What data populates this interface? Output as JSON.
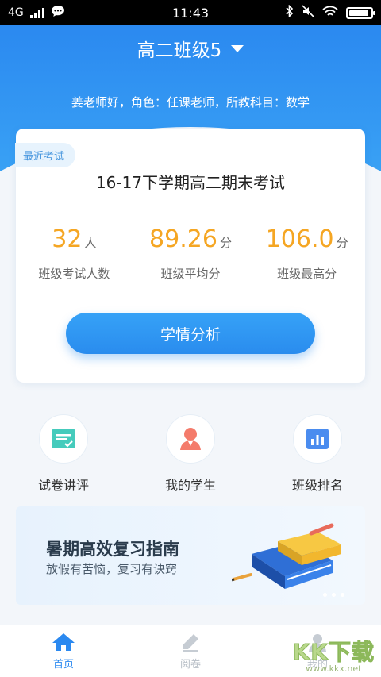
{
  "status_bar": {
    "network": "4G",
    "time": "11:43"
  },
  "header": {
    "class_name": "高二班级5",
    "teacher_info": "姜老师好，角色：任课老师，所教科目：数学"
  },
  "exam_card": {
    "tag": "最近考试",
    "exam_name": "16-17下学期高二期末考试",
    "stats": [
      {
        "value": "32",
        "unit": "人",
        "label": "班级考试人数"
      },
      {
        "value": "89.26",
        "unit": "分",
        "label": "班级平均分"
      },
      {
        "value": "106.0",
        "unit": "分",
        "label": "班级最高分"
      }
    ],
    "button_label": "学情分析"
  },
  "quick_actions": [
    {
      "label": "试卷讲评",
      "icon": "exam-review-icon"
    },
    {
      "label": "我的学生",
      "icon": "student-icon"
    },
    {
      "label": "班级排名",
      "icon": "ranking-icon"
    }
  ],
  "banner": {
    "title": "暑期高效复习指南",
    "subtitle": "放假有苦恼，复习有诀窍"
  },
  "tab_bar": {
    "tabs": [
      {
        "label": "首页",
        "icon": "home-icon",
        "active": true
      },
      {
        "label": "阅卷",
        "icon": "pen-icon",
        "active": false
      },
      {
        "label": "我的",
        "icon": "profile-icon",
        "active": false
      }
    ]
  },
  "watermark": {
    "text": "KK下载",
    "url": "www.kkx.net"
  },
  "colors": {
    "primary": "#2b89f0",
    "accent": "#f5a623",
    "tag_bg": "#e7f3fd"
  }
}
